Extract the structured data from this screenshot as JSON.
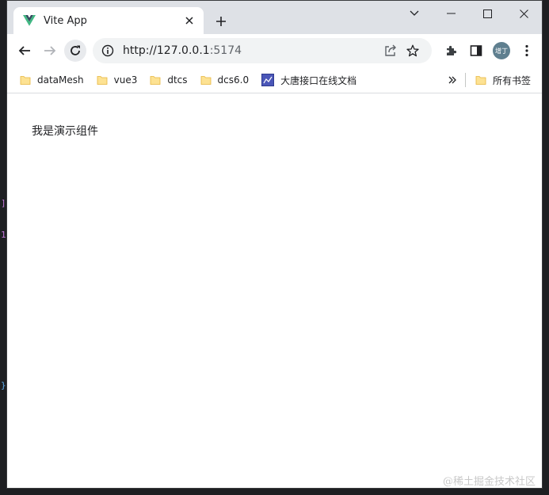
{
  "browser": {
    "tab": {
      "title": "Vite App",
      "favicon": "vue-logo-icon",
      "accent": "#41b883"
    },
    "address_bar": {
      "url_main": "http://127.0.0.1",
      "url_port": ":5174"
    },
    "profile": {
      "avatar_text": "增丁"
    },
    "bookmarks": [
      {
        "label": "dataMesh",
        "icon": "folder-icon"
      },
      {
        "label": "vue3",
        "icon": "folder-icon"
      },
      {
        "label": "dtcs",
        "icon": "folder-icon"
      },
      {
        "label": "dcs6.0",
        "icon": "folder-icon"
      },
      {
        "label": "大唐接口在线文档",
        "icon": "site-favicon-icon"
      }
    ],
    "other_bookmarks": "所有书签"
  },
  "page": {
    "demo_text": "我是演示组件"
  },
  "watermark": "@稀土掘金技术社区",
  "colors": {
    "folder": "#f9d87a",
    "tabstrip": "#dee1e6",
    "avatar": "#5f7f8f"
  }
}
